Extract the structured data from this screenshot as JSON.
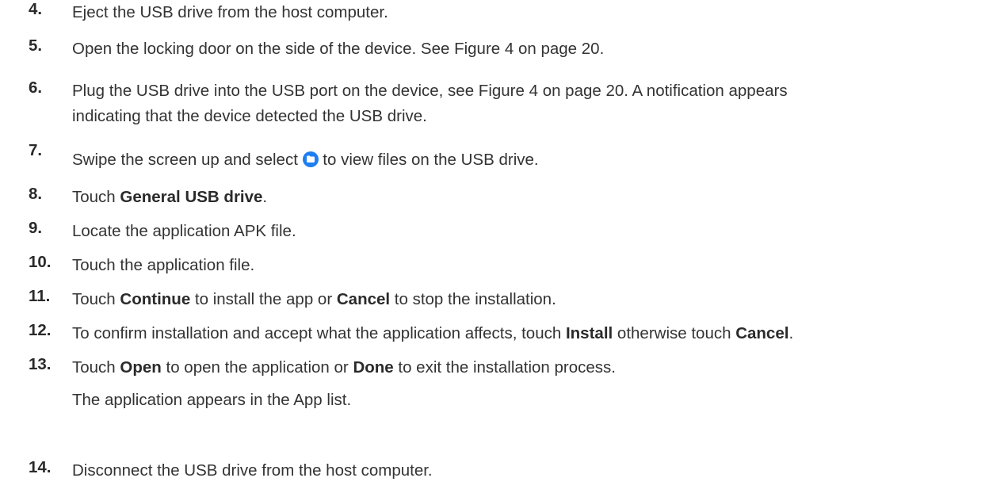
{
  "steps": [
    {
      "num": "4.",
      "parts": [
        "Eject the USB drive from the host computer."
      ]
    },
    {
      "num": "5.",
      "parts": [
        "Open the locking door on the side of the device. See Figure 4 on page 20."
      ]
    },
    {
      "num": "6.",
      "line1": "Plug the USB drive into the USB port on the device, see Figure 4 on page 20. A notification appears",
      "line2": "indicating that the device detected the USB drive."
    },
    {
      "num": "7.",
      "before_icon": "Swipe the screen up and select ",
      "icon": "folder-icon",
      "after_icon": " to view files on the USB drive."
    },
    {
      "num": "8.",
      "parts": [
        "Touch ",
        "General USB drive",
        "."
      ]
    },
    {
      "num": "9.",
      "parts": [
        "Locate the application APK file."
      ]
    },
    {
      "num": "10.",
      "parts": [
        "Touch the application file."
      ]
    },
    {
      "num": "11.",
      "parts": [
        "Touch ",
        "Continue",
        " to install the app or ",
        "Cancel",
        " to stop the installation."
      ]
    },
    {
      "num": "12.",
      "parts": [
        "To confirm installation and accept what the application affects, touch ",
        "Install",
        " otherwise touch ",
        "Cancel",
        "."
      ]
    },
    {
      "num": "13.",
      "parts": [
        "Touch ",
        "Open",
        " to open the application or ",
        "Done",
        " to exit the installation process."
      ],
      "note": "The application appears in the App list."
    },
    {
      "num": "14.",
      "parts": [
        "Disconnect the USB drive from the host computer."
      ]
    }
  ],
  "colors": {
    "text": "#333333",
    "icon": "#1e7ff0"
  }
}
